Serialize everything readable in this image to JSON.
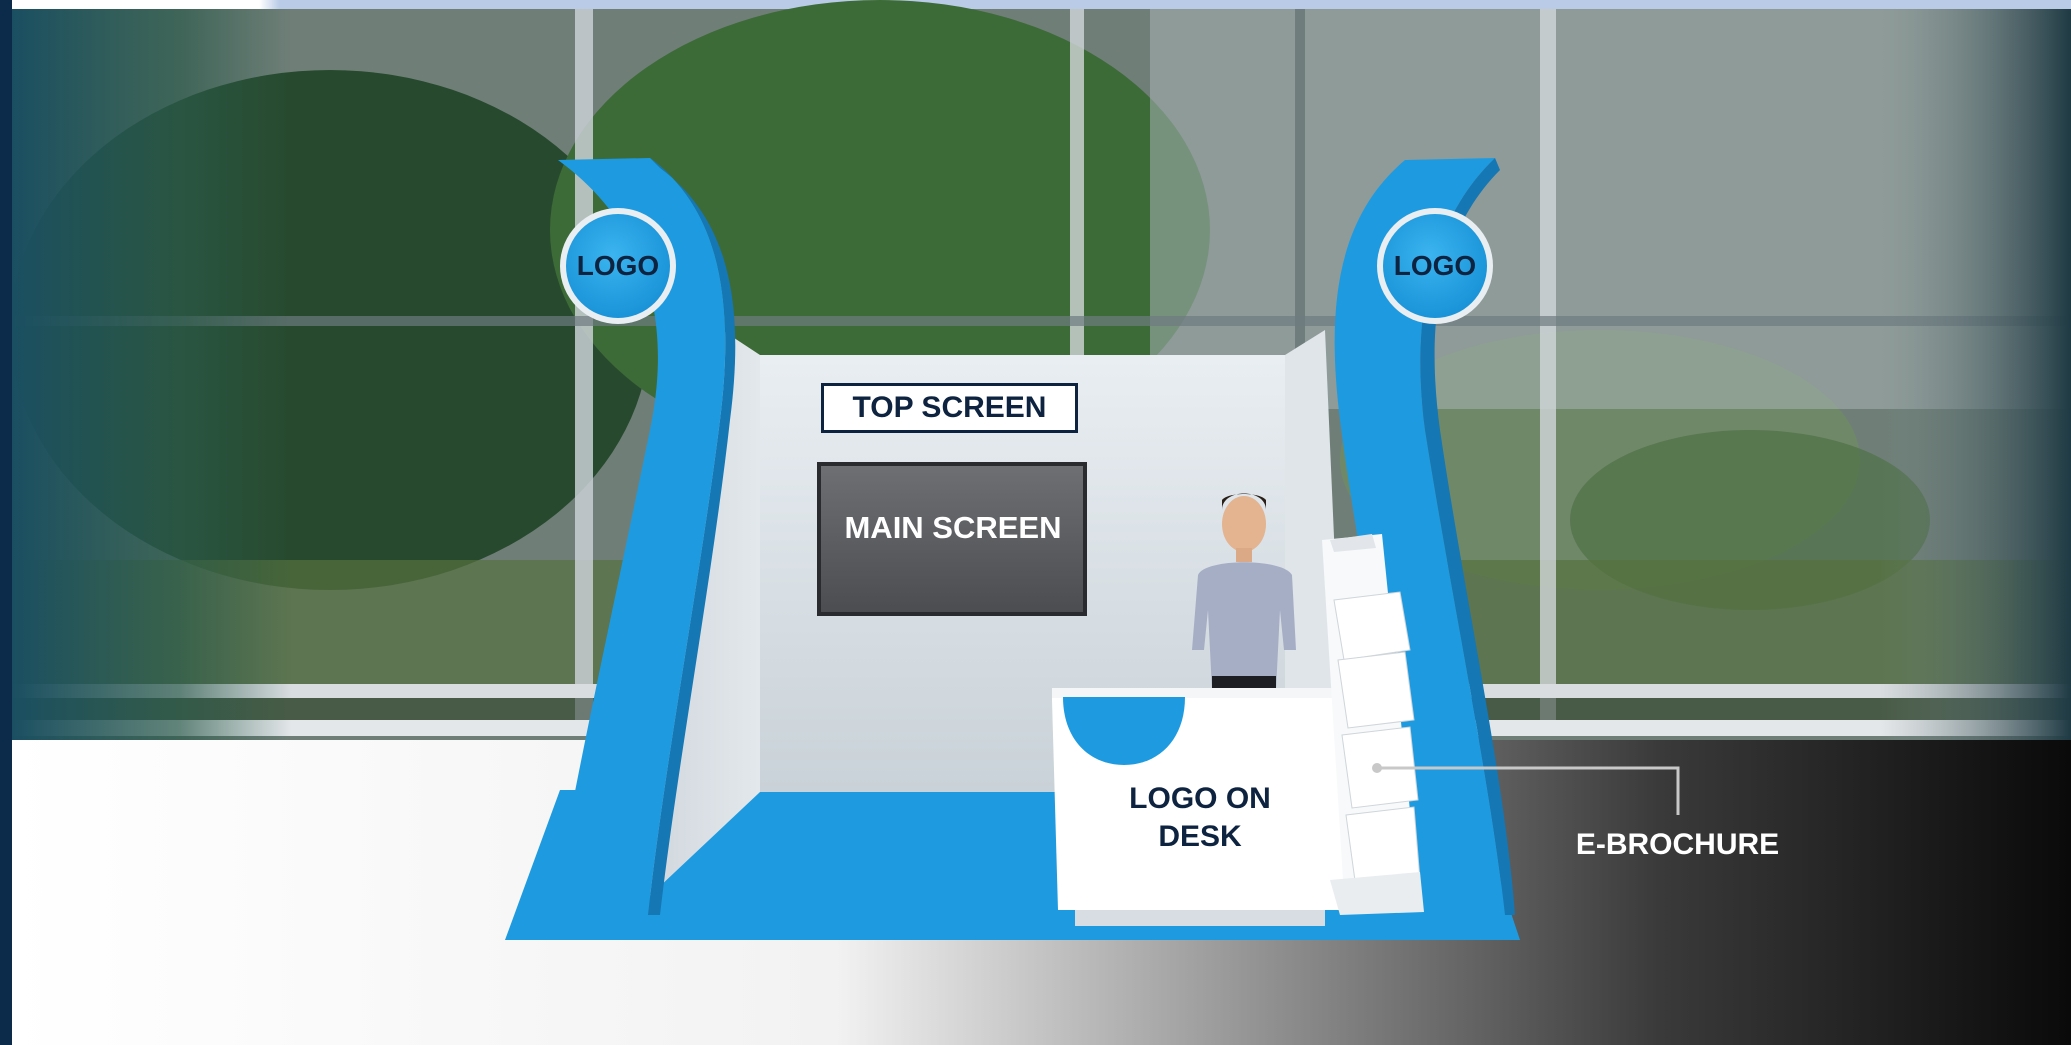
{
  "labels": {
    "logo_left": "LOGO",
    "logo_right": "LOGO",
    "top_screen": "TOP SCREEN",
    "main_screen": "MAIN SCREEN",
    "logo_on_desk": "LOGO ON DESK",
    "e_brochure": "E-BROCHURE"
  },
  "colors": {
    "accent_blue": "#1e9be0",
    "label_navy": "#0d2340",
    "screen_gray": "#5c5e62",
    "frame_navy": "#0c2a4a"
  }
}
